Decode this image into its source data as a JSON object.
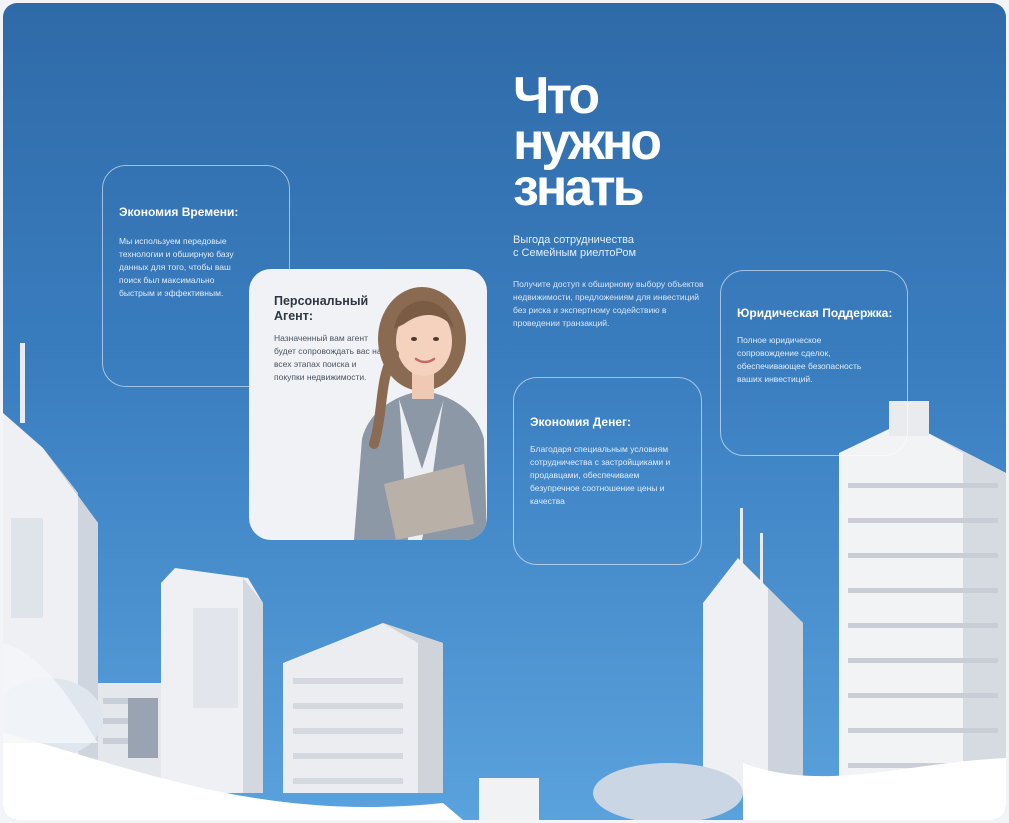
{
  "hero": {
    "title_lines": [
      "Что",
      "нужно",
      "знать"
    ],
    "subtitle_lines": [
      "Выгода сотрудничества",
      "с Семейным риелтоРом"
    ],
    "intro": "Получите доступ к обширному выбору объектов недвижимости, предложениям для инвестиций без риска и экспертному содействию в проведении транзакций."
  },
  "cards": {
    "time": {
      "title": "Экономия Времени:",
      "text": "Мы используем передовые технологии и обширную базу данных для того, чтобы ваш поиск был максимально быстрым и эффективным."
    },
    "agent": {
      "title": "Персональный Агент:",
      "text": "Назначенный вам агент будет сопровождать вас на всех этапах поиска и покупки недвижимости."
    },
    "money": {
      "title": "Экономия Денег:",
      "text": "Благодаря специальным условиям сотрудничества с застройщиками и продавцами, обеспечиваем безупречное соотношение цены и качества"
    },
    "legal": {
      "title": "Юридическая Поддержка:",
      "text": "Полное юридическое сопровождение сделок, обеспечивающее безопасность ваших инвестиций."
    }
  },
  "colors": {
    "background_top": "#2f6aa8",
    "background_bottom": "#5aa2dd",
    "text_light": "#ffffff",
    "agent_card": "#f0f2f5"
  }
}
